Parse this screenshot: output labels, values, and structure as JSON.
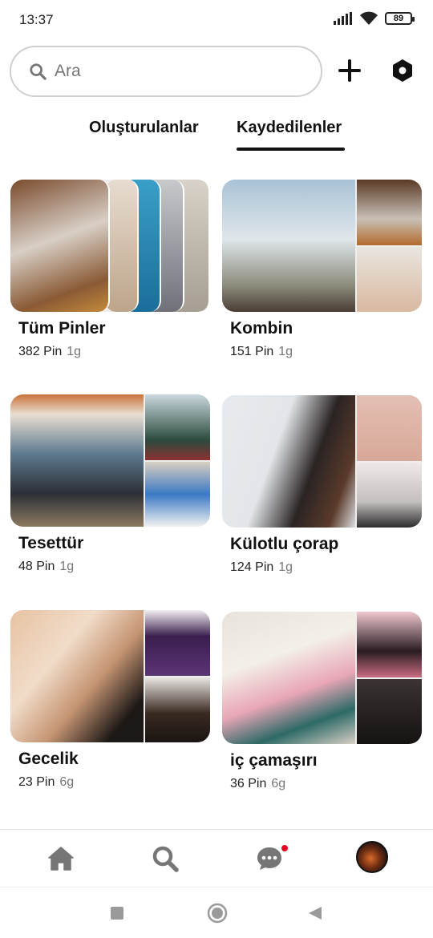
{
  "status": {
    "time": "13:37",
    "battery": "89"
  },
  "search": {
    "placeholder": "Ara"
  },
  "tabs": [
    {
      "label": "Oluşturulanlar"
    },
    {
      "label": "Kaydedilenler"
    }
  ],
  "boards": [
    {
      "title": "Tüm Pinler",
      "pins": "382 Pin",
      "age": "1g"
    },
    {
      "title": "Kombin",
      "pins": "151 Pin",
      "age": "1g"
    },
    {
      "title": "Tesettür",
      "pins": "48 Pin",
      "age": "1g"
    },
    {
      "title": "Külotlu çorap",
      "pins": "124 Pin",
      "age": "1g"
    },
    {
      "title": "Gecelik",
      "pins": "23 Pin",
      "age": "6g"
    },
    {
      "title": "iç çamaşırı",
      "pins": "36 Pin",
      "age": "6g"
    }
  ],
  "icons": {
    "search": "search-icon",
    "add": "plus-icon",
    "settings": "settings-icon",
    "home": "home-icon",
    "explore": "search-icon",
    "messages": "chat-bubble-icon",
    "profile": "avatar"
  },
  "colors": {
    "accent": "#e60023",
    "text": "#111111",
    "muted": "#767676"
  }
}
